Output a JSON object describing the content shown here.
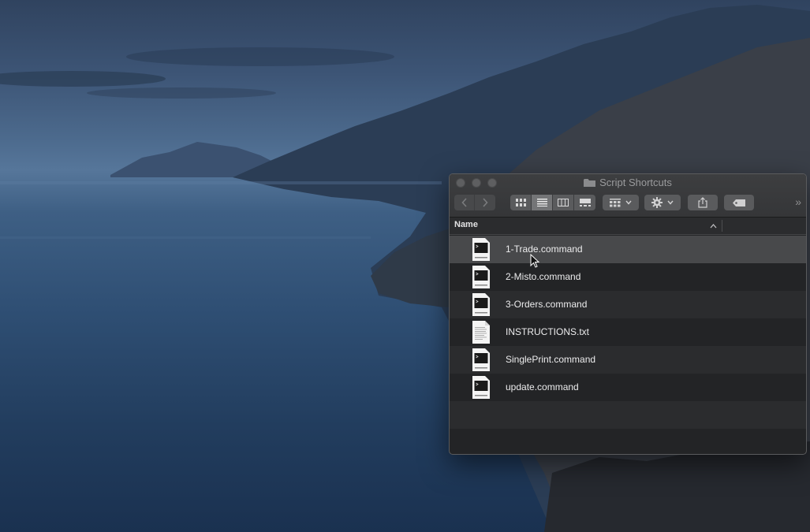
{
  "desktop": {
    "wallpaper": "macOS Catalina island"
  },
  "window": {
    "title": "Script Shortcuts",
    "title_icon": "folder-icon",
    "traffic_lights": [
      "close",
      "minimize",
      "zoom"
    ],
    "toolbar": {
      "nav": [
        "back-icon",
        "forward-icon"
      ],
      "view_modes": [
        "icon-view",
        "list-view",
        "column-view",
        "gallery-view"
      ],
      "active_view": "list-view",
      "buttons": [
        "group-by",
        "action-gear",
        "share",
        "tags"
      ]
    },
    "column_header": {
      "name": "Name",
      "sort_indicator": "^"
    },
    "files": [
      {
        "name": "1-Trade.command",
        "type": "command",
        "selected": true
      },
      {
        "name": "2-Misto.command",
        "type": "command"
      },
      {
        "name": "3-Orders.command",
        "type": "command"
      },
      {
        "name": "INSTRUCTIONS.txt",
        "type": "text"
      },
      {
        "name": "SinglePrint.command",
        "type": "command"
      },
      {
        "name": "update.command",
        "type": "command"
      }
    ],
    "file_type_badge": "command"
  },
  "colors": {
    "window_bg": "#232426",
    "toolbar_bg": "#3a3b3d",
    "row_alt": "#2b2c2e",
    "row_selected": "#48494b",
    "text": "#ececed"
  }
}
